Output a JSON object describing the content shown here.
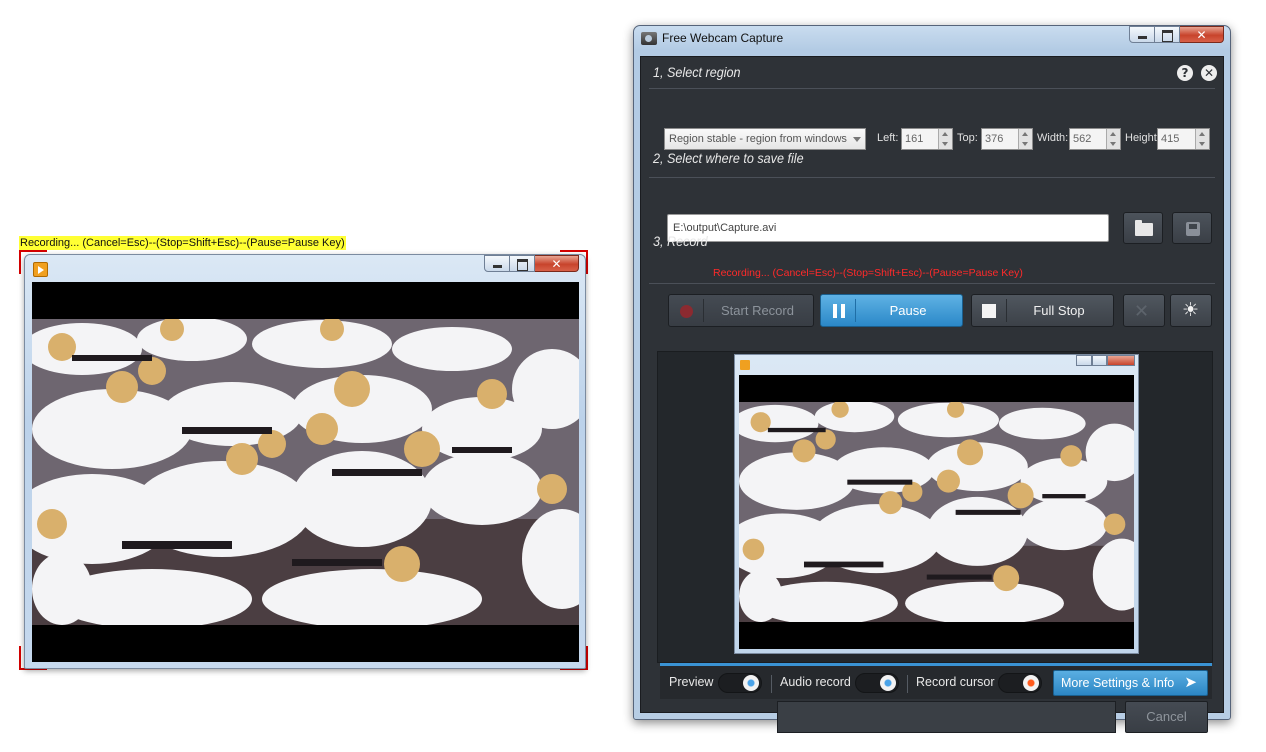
{
  "overlay": {
    "recording_banner": "Recording... (Cancel=Esc)--(Stop=Shift+Esc)--(Pause=Pause Key)"
  },
  "app": {
    "title": "Free Webcam Capture",
    "section1": {
      "title": "1, Select region"
    },
    "region": {
      "mode": "Region stable - region from windows",
      "left_label": "Left:",
      "left_value": "161",
      "top_label": "Top:",
      "top_value": "376",
      "width_label": "Width:",
      "width_value": "562",
      "height_label": "Height",
      "height_value": "415"
    },
    "section2": {
      "title": "2, Select where to save file"
    },
    "save": {
      "path": "E:\\output\\Capture.avi"
    },
    "section3": {
      "title": "3, Record"
    },
    "record_status": "Recording... (Cancel=Esc)--(Stop=Shift+Esc)--(Pause=Pause Key)",
    "controls": {
      "start_label": "Start Record",
      "pause_label": "Pause",
      "stop_label": "Full Stop"
    },
    "options": {
      "preview_label": "Preview",
      "audio_label": "Audio record",
      "cursor_label": "Record cursor",
      "more_label": "More Settings & Info"
    },
    "cancel_label": "Cancel"
  },
  "colors": {
    "accent": "#2b88c8",
    "recording_text": "#ff2a2a",
    "panel": "#2e3237",
    "highlight": "#ffff33"
  }
}
